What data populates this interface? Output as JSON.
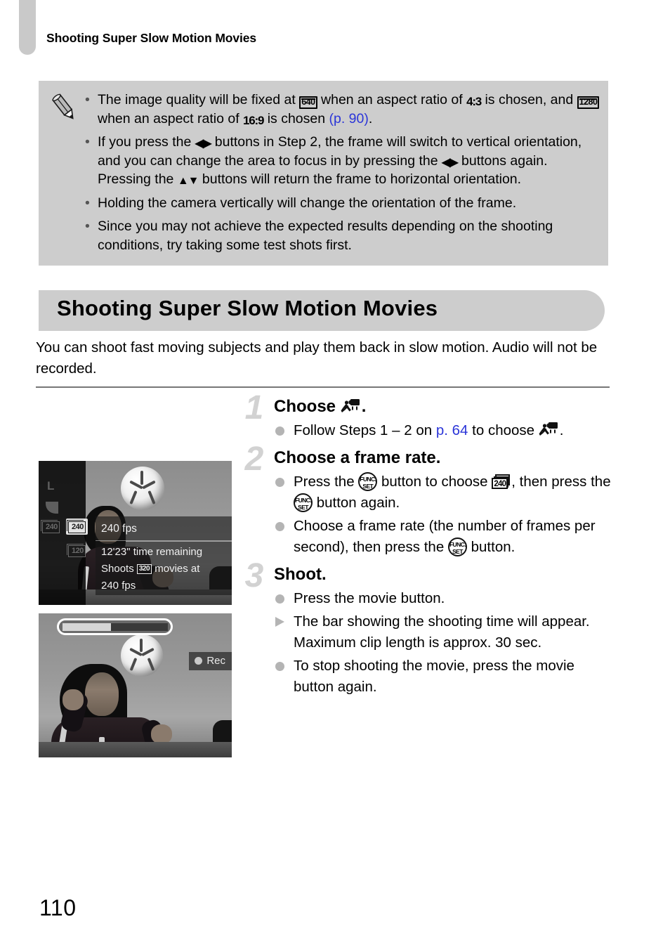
{
  "page": {
    "number": "110",
    "running_header": "Shooting Super Slow Motion Movies"
  },
  "note_box": {
    "icon": "pencil-note-icon",
    "items": [
      {
        "segments": [
          {
            "t": "text",
            "v": "The image quality will be fixed at "
          },
          {
            "t": "icon-box",
            "v": "640"
          },
          {
            "t": "text",
            "v": " when an aspect ratio of "
          },
          {
            "t": "ratio",
            "v": "4:3"
          },
          {
            "t": "text",
            "v": " is chosen, and "
          },
          {
            "t": "icon-box",
            "v": "1280"
          },
          {
            "t": "text",
            "v": " when an aspect ratio of "
          },
          {
            "t": "ratio",
            "v": "16:9"
          },
          {
            "t": "text",
            "v": " is chosen "
          },
          {
            "t": "link",
            "v": "(p. 90)"
          },
          {
            "t": "text",
            "v": "."
          }
        ]
      },
      {
        "segments": [
          {
            "t": "text",
            "v": "If you press the "
          },
          {
            "t": "arrows-lr",
            "v": "◀▶"
          },
          {
            "t": "text",
            "v": " buttons in Step 2, the frame will switch to vertical orientation, and you can change the area to focus in by pressing the "
          },
          {
            "t": "arrows-lr",
            "v": "◀▶"
          },
          {
            "t": "text",
            "v": " buttons again. Pressing the "
          },
          {
            "t": "arrows-ud",
            "v": "▲▼"
          },
          {
            "t": "text",
            "v": " buttons will return the frame to horizontal orientation."
          }
        ]
      },
      {
        "segments": [
          {
            "t": "text",
            "v": "Holding the camera vertically will change the orientation of the frame."
          }
        ]
      },
      {
        "segments": [
          {
            "t": "text",
            "v": "Since you may not achieve the expected results depending on the shooting conditions, try taking some test shots first."
          }
        ]
      }
    ]
  },
  "section": {
    "title": "Shooting Super Slow Motion Movies",
    "intro": "You can shoot fast moving subjects and play them back in slow motion. Audio will not be recorded."
  },
  "steps": [
    {
      "number": "1",
      "heading_segments": [
        {
          "t": "text",
          "v": "Choose "
        },
        {
          "t": "movie-icon",
          "v": "super-slow-motion-movie-icon"
        },
        {
          "t": "text",
          "v": "."
        }
      ],
      "items": [
        {
          "marker": "dot",
          "segments": [
            {
              "t": "text",
              "v": "Follow Steps 1 – 2 on "
            },
            {
              "t": "link",
              "v": "p. 64"
            },
            {
              "t": "text",
              "v": " to choose "
            },
            {
              "t": "movie-icon",
              "v": "super-slow-motion-movie-icon"
            },
            {
              "t": "text",
              "v": "."
            }
          ]
        }
      ]
    },
    {
      "number": "2",
      "heading_segments": [
        {
          "t": "text",
          "v": "Choose a frame rate."
        }
      ],
      "items": [
        {
          "marker": "dot",
          "segments": [
            {
              "t": "text",
              "v": "Press the "
            },
            {
              "t": "funcset",
              "v": "FUNC SET"
            },
            {
              "t": "text",
              "v": " button to choose "
            },
            {
              "t": "fr-icon",
              "v": "240"
            },
            {
              "t": "text",
              "v": ", then press the "
            },
            {
              "t": "funcset",
              "v": "FUNC SET"
            },
            {
              "t": "text",
              "v": " button again."
            }
          ]
        },
        {
          "marker": "dot",
          "segments": [
            {
              "t": "text",
              "v": "Choose a frame rate (the number of frames per second), then press the "
            },
            {
              "t": "funcset",
              "v": "FUNC SET"
            },
            {
              "t": "text",
              "v": " button."
            }
          ]
        }
      ]
    },
    {
      "number": "3",
      "heading_segments": [
        {
          "t": "text",
          "v": "Shoot."
        }
      ],
      "items": [
        {
          "marker": "dot",
          "segments": [
            {
              "t": "text",
              "v": "Press the movie button."
            }
          ]
        },
        {
          "marker": "triangle",
          "segments": [
            {
              "t": "text",
              "v": "The bar showing the shooting time will appear. Maximum clip length is approx. 30 sec."
            }
          ]
        },
        {
          "marker": "dot",
          "segments": [
            {
              "t": "text",
              "v": "To stop shooting the movie, press the movie button again."
            }
          ]
        }
      ]
    }
  ],
  "screenshots": {
    "frame_rate_menu": {
      "alt": "camera-lcd-frame-rate-menu",
      "left_column": {
        "quality_letter": "L",
        "option_selected": "240",
        "option_unselected": "120"
      },
      "info_top": "240 fps",
      "info_lines": [
        "12'23\" time remaining",
        "Shoots",
        "movies at",
        "240 fps"
      ],
      "info_badge": "320",
      "info_line_1": "12'23\" time remaining",
      "info_line_2a": "Shoots",
      "info_line_2b": "movies at",
      "info_line_3": "240 fps"
    },
    "recording": {
      "alt": "camera-lcd-recording",
      "rec_label": "Rec",
      "progress_percent": 46
    }
  },
  "colors": {
    "note_bg": "#cdcdcd",
    "section_bg": "#cdcdcd",
    "link": "#2b35d8",
    "step_number": "#d2d2d2",
    "rule": "#767676"
  }
}
